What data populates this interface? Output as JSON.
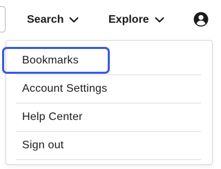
{
  "header": {
    "search_label": "Search",
    "explore_label": "Explore",
    "chevron_icon": "chevron-down-icon",
    "avatar_icon": "user-circle-icon"
  },
  "dropdown": {
    "items": [
      {
        "label": "Bookmarks",
        "focused": true
      },
      {
        "label": "Account Settings",
        "focused": false
      },
      {
        "label": "Help Center",
        "focused": false
      },
      {
        "label": "Sign out",
        "focused": false
      }
    ]
  },
  "colors": {
    "focus_ring": "#3b5bdb",
    "text": "#1a1a1a",
    "divider": "#dcdcdc"
  }
}
